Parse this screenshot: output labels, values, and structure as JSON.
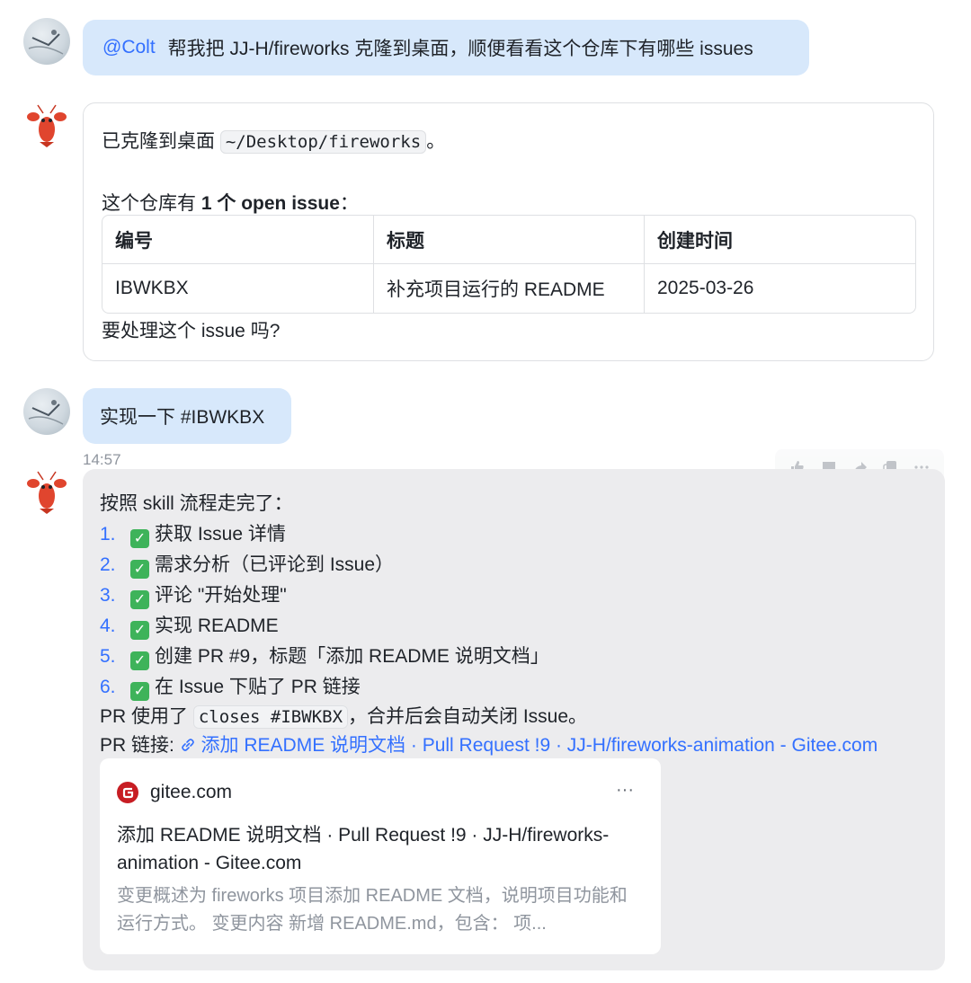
{
  "messages": {
    "user1": {
      "mention": "@Colt",
      "text": "帮我把 JJ-H/fireworks 克隆到桌面，顺便看看这个仓库下有哪些 issues"
    },
    "bot1": {
      "cloned_prefix": "已克隆到桌面",
      "path": "~/Desktop/fireworks",
      "cloned_suffix": "。",
      "summary_prefix": "这个仓库有",
      "summary_bold": "1 个 open issue",
      "summary_suffix": "：",
      "table": {
        "headers": [
          "编号",
          "标题",
          "创建时间"
        ],
        "rows": [
          [
            "IBWKBX",
            "补充项目运行的 README",
            "2025-03-26"
          ]
        ]
      },
      "question": "要处理这个 issue 吗?"
    },
    "user2": {
      "text": "实现一下 #IBWKBX"
    },
    "timestamp": "14:57",
    "bot2": {
      "intro": "按照 skill 流程走完了：",
      "steps": [
        {
          "num": "1.",
          "text": "获取 Issue 详情"
        },
        {
          "num": "2.",
          "text": "需求分析（已评论到 Issue）"
        },
        {
          "num": "3.",
          "text": "评论 \"开始处理\""
        },
        {
          "num": "4.",
          "text": "实现 README"
        },
        {
          "num": "5.",
          "text": "创建 PR #9，标题「添加 README 说明文档」"
        },
        {
          "num": "6.",
          "text": "在 Issue 下贴了 PR 链接"
        }
      ],
      "close_prefix": "PR 使用了",
      "close_code": "closes #IBWKBX",
      "close_suffix": "，合并后会自动关闭 Issue。",
      "link_label": "PR 链接:",
      "link_text": "添加 README 说明文档 · Pull Request !9 · JJ-H/fireworks-animation - Gitee.com",
      "preview": {
        "site": "gitee.com",
        "more": "···",
        "title": "添加 README 说明文档 · Pull Request !9 · JJ-H/fireworks-animation - Gitee.com",
        "description": "变更概述为 fireworks 项目添加 README 文档，说明项目功能和运行方式。 变更内容 新增 README.md，包含：  项..."
      }
    }
  },
  "icons": [
    "thumbs-up-icon",
    "comment-icon",
    "share-icon",
    "copy-icon",
    "more-icon",
    "link-icon",
    "gitee-logo-icon",
    "check-icon",
    "lobster-avatar-icon"
  ],
  "colors": {
    "accent": "#3370ff",
    "user_bubble": "#d7e8fb",
    "bot_bubble": "#ececee",
    "check": "#3eb35a",
    "gitee": "#c71d23"
  }
}
